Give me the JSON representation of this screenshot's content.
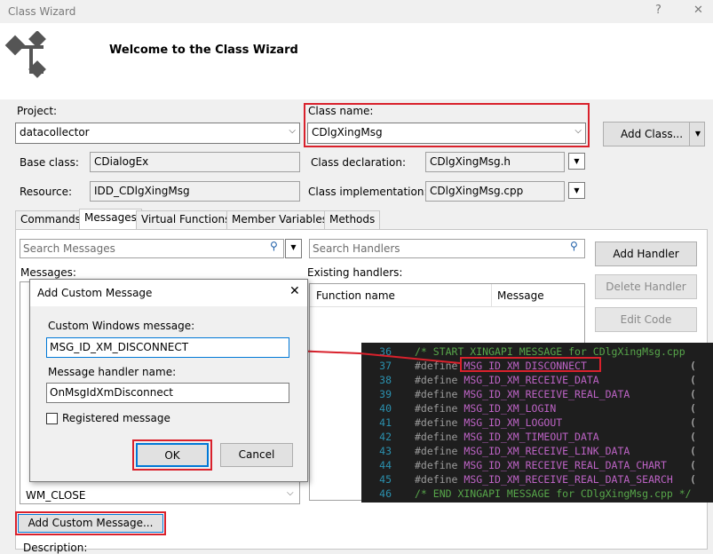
{
  "window": {
    "title": "Class Wizard",
    "help_btn": "?",
    "close_btn": "✕"
  },
  "header": {
    "welcome": "Welcome to the Class Wizard"
  },
  "form": {
    "project_label": "Project:",
    "project_value": "datacollector",
    "classname_label": "Class name:",
    "classname_value": "CDlgXingMsg",
    "add_class": "Add Class...",
    "base_class_label": "Base class:",
    "base_class_value": "CDialogEx",
    "class_decl_label": "Class declaration:",
    "class_decl_value": "CDlgXingMsg.h",
    "resource_label": "Resource:",
    "resource_value": "IDD_CDlgXingMsg",
    "class_impl_label": "Class implementation:",
    "class_impl_value": "CDlgXingMsg.cpp"
  },
  "tabs": [
    "Commands",
    "Messages",
    "Virtual Functions",
    "Member Variables",
    "Methods"
  ],
  "messages_panel": {
    "search_messages": "Search Messages",
    "search_handlers": "Search Handlers",
    "messages_label": "Messages:",
    "existing_label": "Existing handlers:",
    "col_function": "Function name",
    "col_message": "Message",
    "last_message": "WM_CLOSE",
    "add_handler": "Add Handler",
    "delete_handler": "Delete Handler",
    "edit_code": "Edit Code",
    "add_custom": "Add Custom Message...",
    "description_label": "Description:"
  },
  "dialog": {
    "title": "Add Custom Message",
    "msg_label": "Custom Windows message:",
    "msg_value": "MSG_ID_XM_DISCONNECT",
    "handler_label": "Message handler name:",
    "handler_value": "OnMsgIdXmDisconnect",
    "registered_label": "Registered message",
    "ok": "OK",
    "cancel": "Cancel"
  },
  "code": [
    {
      "line": "36",
      "kind": "comment",
      "text": "/* START XINGAPI MESSAGE for CDlgXingMsg.cpp"
    },
    {
      "line": "37",
      "kind": "define",
      "directive": "#define",
      "name": "MSG_ID_XM_DISCONNECT",
      "tail": "("
    },
    {
      "line": "38",
      "kind": "define",
      "directive": "#define",
      "name": "MSG_ID_XM_RECEIVE_DATA",
      "tail": "("
    },
    {
      "line": "39",
      "kind": "define",
      "directive": "#define",
      "name": "MSG_ID_XM_RECEIVE_REAL_DATA",
      "tail": "("
    },
    {
      "line": "40",
      "kind": "define",
      "directive": "#define",
      "name": "MSG_ID_XM_LOGIN",
      "tail": "("
    },
    {
      "line": "41",
      "kind": "define",
      "directive": "#define",
      "name": "MSG_ID_XM_LOGOUT",
      "tail": "("
    },
    {
      "line": "42",
      "kind": "define",
      "directive": "#define",
      "name": "MSG_ID_XM_TIMEOUT_DATA",
      "tail": "("
    },
    {
      "line": "43",
      "kind": "define",
      "directive": "#define",
      "name": "MSG_ID_XM_RECEIVE_LINK_DATA",
      "tail": "("
    },
    {
      "line": "44",
      "kind": "define",
      "directive": "#define",
      "name": "MSG_ID_XM_RECEIVE_REAL_DATA_CHART",
      "tail": "("
    },
    {
      "line": "45",
      "kind": "define",
      "directive": "#define",
      "name": "MSG_ID_XM_RECEIVE_REAL_DATA_SEARCH",
      "tail": "("
    },
    {
      "line": "46",
      "kind": "comment",
      "text": "/* END XINGAPI MESSAGE for CDlgXingMsg.cpp */"
    }
  ],
  "colors": {
    "highlight": "#d9212c",
    "code_bg": "#1e1e1e",
    "comment": "#57a64a",
    "macro": "#bd63c5"
  }
}
